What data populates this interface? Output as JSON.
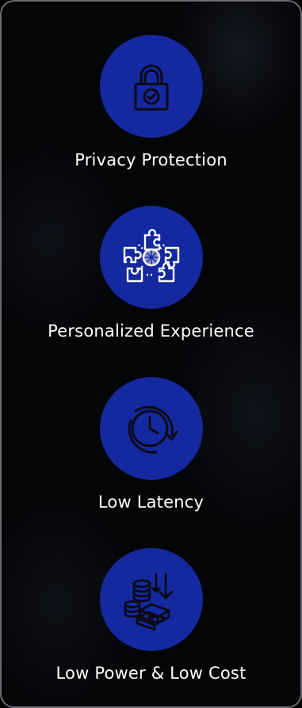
{
  "features": [
    {
      "label": "Privacy Protection",
      "icon": "padlock-check-icon"
    },
    {
      "label": "Personalized Experience",
      "icon": "puzzle-network-icon"
    },
    {
      "label": "Low Latency",
      "icon": "clock-refresh-icon"
    },
    {
      "label": "Low Power & Low Cost",
      "icon": "coins-down-arrow-icon"
    }
  ],
  "colors": {
    "circle": "#1428a0",
    "background": "#040507",
    "border": "#6b6b70",
    "text": "#ffffff"
  }
}
